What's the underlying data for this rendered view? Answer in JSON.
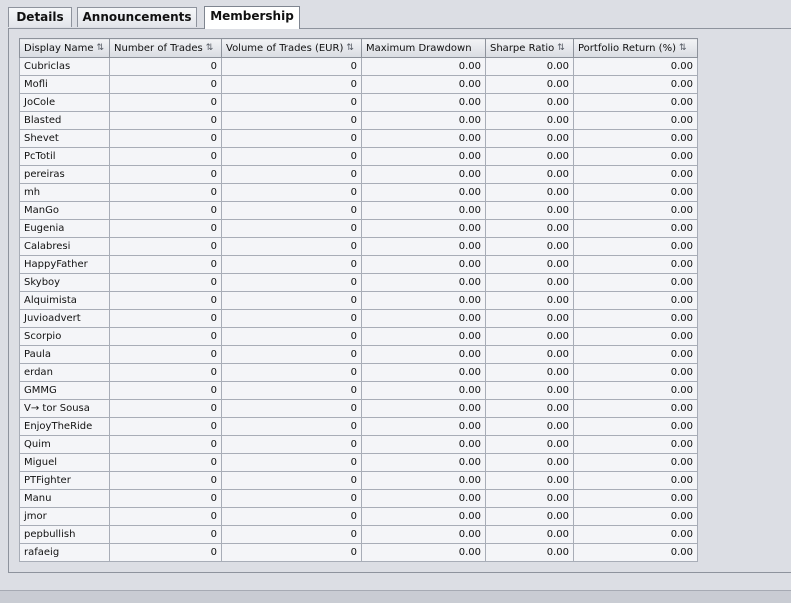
{
  "tabs": [
    {
      "label": "Details",
      "active": false
    },
    {
      "label": "Announcements",
      "active": false
    },
    {
      "label": "Membership",
      "active": true
    }
  ],
  "table": {
    "columns": [
      {
        "key": "display_name",
        "label": "Display Name"
      },
      {
        "key": "number_of_trades",
        "label": "Number of Trades"
      },
      {
        "key": "volume_of_trades",
        "label": "Volume of Trades (EUR)"
      },
      {
        "key": "maximum_drawdown",
        "label": "Maximum Drawdown"
      },
      {
        "key": "sharpe_ratio",
        "label": "Sharpe Ratio"
      },
      {
        "key": "portfolio_return",
        "label": "Portfolio Return (%)"
      }
    ],
    "sort_icon": "sort-updown-icon",
    "rows": [
      [
        "Cubriclas",
        "0",
        "0",
        "0.00",
        "0.00",
        "0.00"
      ],
      [
        "Mofli",
        "0",
        "0",
        "0.00",
        "0.00",
        "0.00"
      ],
      [
        "JoCole",
        "0",
        "0",
        "0.00",
        "0.00",
        "0.00"
      ],
      [
        "Blasted",
        "0",
        "0",
        "0.00",
        "0.00",
        "0.00"
      ],
      [
        "Shevet",
        "0",
        "0",
        "0.00",
        "0.00",
        "0.00"
      ],
      [
        "PcTotil",
        "0",
        "0",
        "0.00",
        "0.00",
        "0.00"
      ],
      [
        "pereiras",
        "0",
        "0",
        "0.00",
        "0.00",
        "0.00"
      ],
      [
        "mh",
        "0",
        "0",
        "0.00",
        "0.00",
        "0.00"
      ],
      [
        "ManGo",
        "0",
        "0",
        "0.00",
        "0.00",
        "0.00"
      ],
      [
        "Eugenia",
        "0",
        "0",
        "0.00",
        "0.00",
        "0.00"
      ],
      [
        "Calabresi",
        "0",
        "0",
        "0.00",
        "0.00",
        "0.00"
      ],
      [
        "HappyFather",
        "0",
        "0",
        "0.00",
        "0.00",
        "0.00"
      ],
      [
        "Skyboy",
        "0",
        "0",
        "0.00",
        "0.00",
        "0.00"
      ],
      [
        "Alquimista",
        "0",
        "0",
        "0.00",
        "0.00",
        "0.00"
      ],
      [
        "Juvioadvert",
        "0",
        "0",
        "0.00",
        "0.00",
        "0.00"
      ],
      [
        "Scorpio",
        "0",
        "0",
        "0.00",
        "0.00",
        "0.00"
      ],
      [
        "Paula",
        "0",
        "0",
        "0.00",
        "0.00",
        "0.00"
      ],
      [
        "erdan",
        "0",
        "0",
        "0.00",
        "0.00",
        "0.00"
      ],
      [
        "GMMG",
        "0",
        "0",
        "0.00",
        "0.00",
        "0.00"
      ],
      [
        "V→ tor Sousa",
        "0",
        "0",
        "0.00",
        "0.00",
        "0.00"
      ],
      [
        "EnjoyTheRide",
        "0",
        "0",
        "0.00",
        "0.00",
        "0.00"
      ],
      [
        "Quim",
        "0",
        "0",
        "0.00",
        "0.00",
        "0.00"
      ],
      [
        "Miguel",
        "0",
        "0",
        "0.00",
        "0.00",
        "0.00"
      ],
      [
        "PTFighter",
        "0",
        "0",
        "0.00",
        "0.00",
        "0.00"
      ],
      [
        "Manu",
        "0",
        "0",
        "0.00",
        "0.00",
        "0.00"
      ],
      [
        "jmor",
        "0",
        "0",
        "0.00",
        "0.00",
        "0.00"
      ],
      [
        "pepbullish",
        "0",
        "0",
        "0.00",
        "0.00",
        "0.00"
      ],
      [
        "rafaeig",
        "0",
        "0",
        "0.00",
        "0.00",
        "0.00"
      ]
    ]
  }
}
